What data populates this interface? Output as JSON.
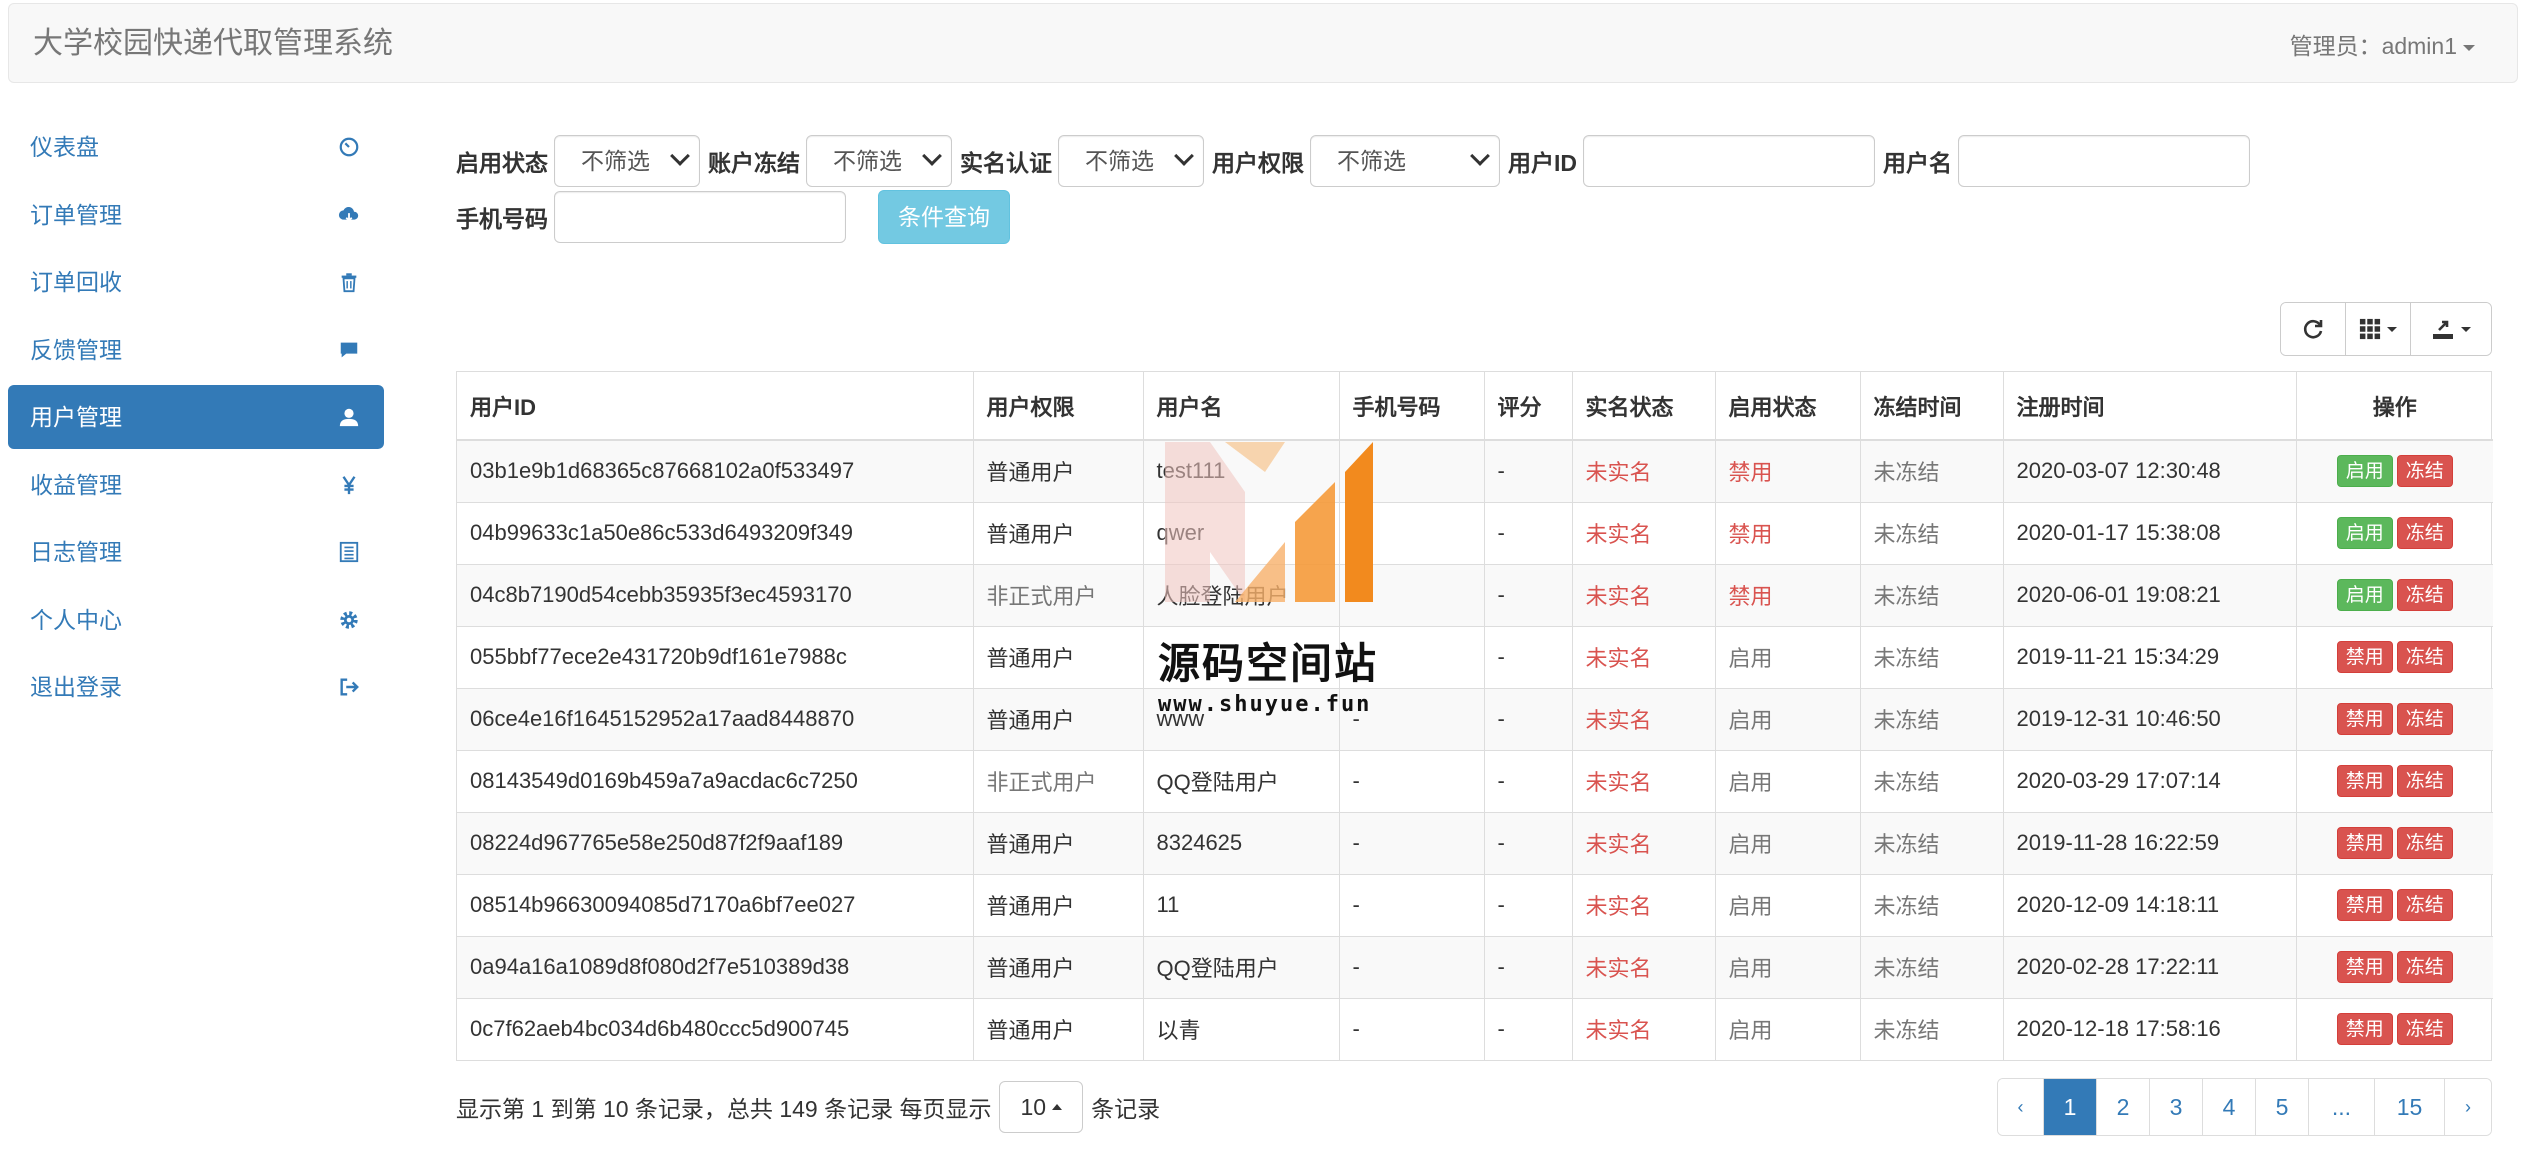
{
  "navbar": {
    "brand": "大学校园快递代取管理系统",
    "admin_label": "管理员：admin1"
  },
  "sidebar": {
    "items": [
      {
        "label": "仪表盘",
        "icon": "dashboard-icon"
      },
      {
        "label": "订单管理",
        "icon": "cloud-download-icon"
      },
      {
        "label": "订单回收",
        "icon": "trash-icon"
      },
      {
        "label": "反馈管理",
        "icon": "comment-icon"
      },
      {
        "label": "用户管理",
        "icon": "user-icon",
        "active": true
      },
      {
        "label": "收益管理",
        "icon": "yen-icon"
      },
      {
        "label": "日志管理",
        "icon": "list-icon"
      },
      {
        "label": "个人中心",
        "icon": "gear-icon"
      },
      {
        "label": "退出登录",
        "icon": "logout-icon"
      }
    ]
  },
  "filters": {
    "enable_status_label": "启用状态",
    "enable_status_value": "不筛选",
    "freeze_label": "账户冻结",
    "freeze_value": "不筛选",
    "realname_label": "实名认证",
    "realname_value": "不筛选",
    "permission_label": "用户权限",
    "permission_value": "不筛选",
    "userid_label": "用户ID",
    "userid_value": "",
    "username_label": "用户名",
    "username_value": "",
    "phone_label": "手机号码",
    "phone_value": "",
    "query_button": "条件查询"
  },
  "table": {
    "headers": [
      "用户ID",
      "用户权限",
      "用户名",
      "手机号码",
      "评分",
      "实名状态",
      "启用状态",
      "冻结时间",
      "注册时间",
      "操作"
    ],
    "rows": [
      {
        "id": "03b1e9b1d68365c87668102a0f533497",
        "perm": "普通用户",
        "perm_muted": false,
        "name": "test111",
        "phone": "",
        "score": "-",
        "realname": "未实名",
        "enabled": "禁用",
        "enabled_red": true,
        "freeze": "未冻结",
        "reg": "2020-03-07 12:30:48",
        "btn1": "启用",
        "btn1_green": true,
        "btn2": "冻结"
      },
      {
        "id": "04b99633c1a50e86c533d6493209f349",
        "perm": "普通用户",
        "perm_muted": false,
        "name": "qwer",
        "phone": "",
        "score": "-",
        "realname": "未实名",
        "enabled": "禁用",
        "enabled_red": true,
        "freeze": "未冻结",
        "reg": "2020-01-17 15:38:08",
        "btn1": "启用",
        "btn1_green": true,
        "btn2": "冻结"
      },
      {
        "id": "04c8b7190d54cebb35935f3ec4593170",
        "perm": "非正式用户",
        "perm_muted": true,
        "name": "人脸登陆用户",
        "phone": "",
        "score": "-",
        "realname": "未实名",
        "enabled": "禁用",
        "enabled_red": true,
        "freeze": "未冻结",
        "reg": "2020-06-01 19:08:21",
        "btn1": "启用",
        "btn1_green": true,
        "btn2": "冻结"
      },
      {
        "id": "055bbf77ece2e431720b9df161e7988c",
        "perm": "普通用户",
        "perm_muted": false,
        "name": "",
        "phone": "",
        "score": "-",
        "realname": "未实名",
        "enabled": "启用",
        "enabled_red": false,
        "freeze": "未冻结",
        "reg": "2019-11-21 15:34:29",
        "btn1": "禁用",
        "btn1_green": false,
        "btn2": "冻结"
      },
      {
        "id": "06ce4e16f1645152952a17aad8448870",
        "perm": "普通用户",
        "perm_muted": false,
        "name": "www",
        "phone": "-",
        "score": "-",
        "realname": "未实名",
        "enabled": "启用",
        "enabled_red": false,
        "freeze": "未冻结",
        "reg": "2019-12-31 10:46:50",
        "btn1": "禁用",
        "btn1_green": false,
        "btn2": "冻结"
      },
      {
        "id": "08143549d0169b459a7a9acdac6c7250",
        "perm": "非正式用户",
        "perm_muted": true,
        "name": "QQ登陆用户",
        "phone": "-",
        "score": "-",
        "realname": "未实名",
        "enabled": "启用",
        "enabled_red": false,
        "freeze": "未冻结",
        "reg": "2020-03-29 17:07:14",
        "btn1": "禁用",
        "btn1_green": false,
        "btn2": "冻结"
      },
      {
        "id": "08224d967765e58e250d87f2f9aaf189",
        "perm": "普通用户",
        "perm_muted": false,
        "name": "8324625",
        "phone": "-",
        "score": "-",
        "realname": "未实名",
        "enabled": "启用",
        "enabled_red": false,
        "freeze": "未冻结",
        "reg": "2019-11-28 16:22:59",
        "btn1": "禁用",
        "btn1_green": false,
        "btn2": "冻结"
      },
      {
        "id": "08514b96630094085d7170a6bf7ee027",
        "perm": "普通用户",
        "perm_muted": false,
        "name": "11",
        "phone": "-",
        "score": "-",
        "realname": "未实名",
        "enabled": "启用",
        "enabled_red": false,
        "freeze": "未冻结",
        "reg": "2020-12-09 14:18:11",
        "btn1": "禁用",
        "btn1_green": false,
        "btn2": "冻结"
      },
      {
        "id": "0a94a16a1089d8f080d2f7e510389d38",
        "perm": "普通用户",
        "perm_muted": false,
        "name": "QQ登陆用户",
        "phone": "-",
        "score": "-",
        "realname": "未实名",
        "enabled": "启用",
        "enabled_red": false,
        "freeze": "未冻结",
        "reg": "2020-02-28 17:22:11",
        "btn1": "禁用",
        "btn1_green": false,
        "btn2": "冻结"
      },
      {
        "id": "0c7f62aeb4bc034d6b480ccc5d900745",
        "perm": "普通用户",
        "perm_muted": false,
        "name": "以青",
        "phone": "-",
        "score": "-",
        "realname": "未实名",
        "enabled": "启用",
        "enabled_red": false,
        "freeze": "未冻结",
        "reg": "2020-12-18 17:58:16",
        "btn1": "禁用",
        "btn1_green": false,
        "btn2": "冻结"
      }
    ]
  },
  "pagination": {
    "info_prefix": "显示第 1 到第 10 条记录，总共 149 条记录 每页显示",
    "page_size": "10",
    "info_suffix": "条记录",
    "prev": "‹",
    "pages": [
      "1",
      "2",
      "3",
      "4",
      "5",
      "...",
      "15"
    ],
    "active_page": "1",
    "next": "›"
  },
  "watermark": {
    "title": "源码空间站",
    "url": "www.shuyue.fun"
  },
  "colors": {
    "primary": "#337ab7",
    "danger": "#d9534f",
    "success": "#5cb85c",
    "info": "#5bc0de"
  }
}
